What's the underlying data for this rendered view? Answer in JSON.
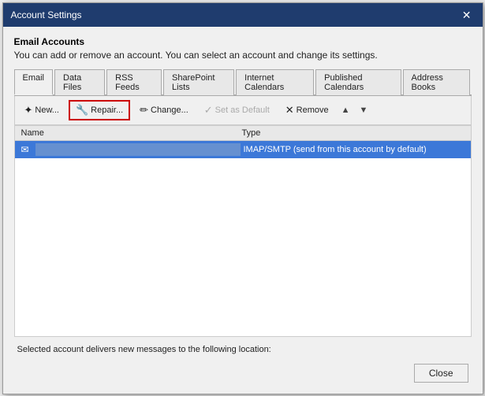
{
  "dialog": {
    "title": "Account Settings",
    "close_label": "✕"
  },
  "header": {
    "section_title": "Email Accounts",
    "section_desc": "You can add or remove an account. You can select an account and change its settings."
  },
  "tabs": [
    {
      "id": "email",
      "label": "Email",
      "active": true
    },
    {
      "id": "data-files",
      "label": "Data Files",
      "active": false
    },
    {
      "id": "rss-feeds",
      "label": "RSS Feeds",
      "active": false
    },
    {
      "id": "sharepoint",
      "label": "SharePoint Lists",
      "active": false
    },
    {
      "id": "internet-cal",
      "label": "Internet Calendars",
      "active": false
    },
    {
      "id": "published-cal",
      "label": "Published Calendars",
      "active": false
    },
    {
      "id": "address-books",
      "label": "Address Books",
      "active": false
    }
  ],
  "toolbar": {
    "new_label": "New...",
    "repair_label": "Repair...",
    "change_label": "Change...",
    "set_default_label": "Set as Default",
    "remove_label": "Remove"
  },
  "table": {
    "col_name": "Name",
    "col_type": "Type",
    "rows": [
      {
        "name": "",
        "type": "IMAP/SMTP (send from this account by default)",
        "selected": true,
        "icon": "✉"
      }
    ]
  },
  "status": {
    "text": "Selected account delivers new messages to the following location:"
  },
  "footer": {
    "close_label": "Close"
  },
  "icons": {
    "new": "✦",
    "repair": "🔧",
    "change": "🖊",
    "check": "✓",
    "remove": "✕",
    "up": "▲",
    "down": "▼",
    "email_row": "✉"
  }
}
